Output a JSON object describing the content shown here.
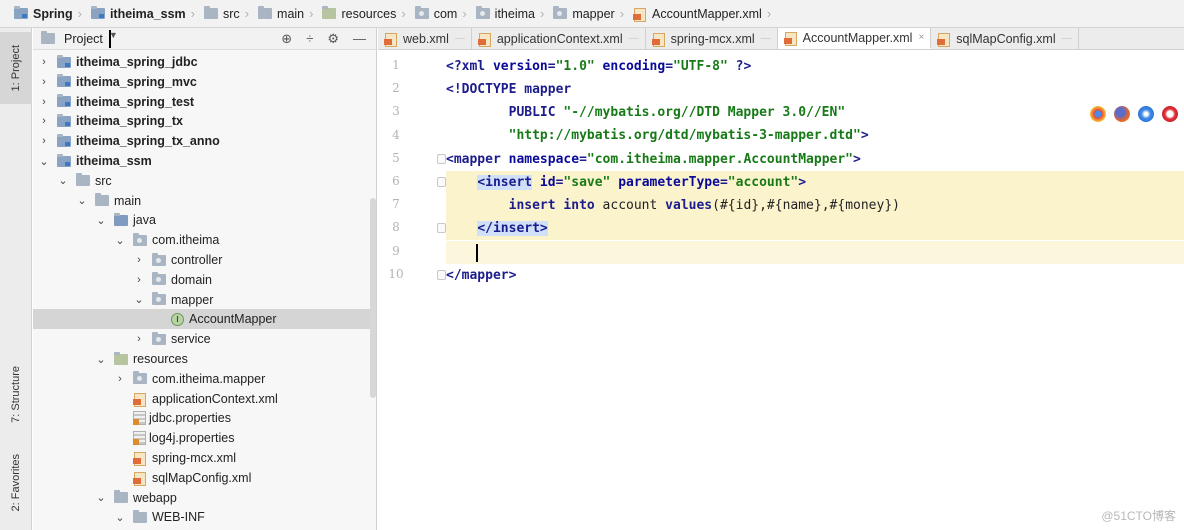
{
  "breadcrumb": [
    "Spring",
    "itheima_ssm",
    "src",
    "main",
    "resources",
    "com",
    "itheima",
    "mapper",
    "AccountMapper.xml"
  ],
  "toolstrip": {
    "project_tab": "1: Project",
    "structure_tab": "7: Structure",
    "favorites_tab": "2: Favorites"
  },
  "project_panel": {
    "title": "Project",
    "tree": [
      {
        "label": "itheima_spring_jdbc",
        "depth": 1,
        "chev": "›",
        "icon": "module",
        "bold": true
      },
      {
        "label": "itheima_spring_mvc",
        "depth": 1,
        "chev": "›",
        "icon": "module",
        "bold": true
      },
      {
        "label": "itheima_spring_test",
        "depth": 1,
        "chev": "›",
        "icon": "module",
        "bold": true
      },
      {
        "label": "itheima_spring_tx",
        "depth": 1,
        "chev": "›",
        "icon": "module",
        "bold": true
      },
      {
        "label": "itheima_spring_tx_anno",
        "depth": 1,
        "chev": "›",
        "icon": "module",
        "bold": true
      },
      {
        "label": "itheima_ssm",
        "depth": 1,
        "chev": "⌄",
        "icon": "module",
        "bold": true
      },
      {
        "label": "src",
        "depth": 2,
        "chev": "⌄",
        "icon": "folder"
      },
      {
        "label": "main",
        "depth": 3,
        "chev": "⌄",
        "icon": "folder"
      },
      {
        "label": "java",
        "depth": 4,
        "chev": "⌄",
        "icon": "source"
      },
      {
        "label": "com.itheima",
        "depth": 5,
        "chev": "⌄",
        "icon": "package"
      },
      {
        "label": "controller",
        "depth": 6,
        "chev": "›",
        "icon": "package"
      },
      {
        "label": "domain",
        "depth": 6,
        "chev": "›",
        "icon": "package"
      },
      {
        "label": "mapper",
        "depth": 6,
        "chev": "⌄",
        "icon": "package"
      },
      {
        "label": "AccountMapper",
        "depth": 7,
        "chev": "",
        "icon": "interface",
        "selected": true
      },
      {
        "label": "service",
        "depth": 6,
        "chev": "›",
        "icon": "package"
      },
      {
        "label": "resources",
        "depth": 4,
        "chev": "⌄",
        "icon": "resources"
      },
      {
        "label": "com.itheima.mapper",
        "depth": 5,
        "chev": "›",
        "icon": "package"
      },
      {
        "label": "applicationContext.xml",
        "depth": 5,
        "chev": "",
        "icon": "xml"
      },
      {
        "label": "jdbc.properties",
        "depth": 5,
        "chev": "",
        "icon": "properties"
      },
      {
        "label": "log4j.properties",
        "depth": 5,
        "chev": "",
        "icon": "properties"
      },
      {
        "label": "spring-mcx.xml",
        "depth": 5,
        "chev": "",
        "icon": "xml"
      },
      {
        "label": "sqlMapConfig.xml",
        "depth": 5,
        "chev": "",
        "icon": "xml"
      },
      {
        "label": "webapp",
        "depth": 4,
        "chev": "⌄",
        "icon": "folder"
      },
      {
        "label": "WEB-INF",
        "depth": 5,
        "chev": "⌄",
        "icon": "folder"
      }
    ]
  },
  "editor": {
    "tabs": [
      {
        "label": "web.xml",
        "active": false
      },
      {
        "label": "applicationContext.xml",
        "active": false
      },
      {
        "label": "spring-mcx.xml",
        "active": false
      },
      {
        "label": "AccountMapper.xml",
        "active": true
      },
      {
        "label": "sqlMapConfig.xml",
        "active": false
      }
    ],
    "line_numbers": [
      "1",
      "2",
      "3",
      "4",
      "5",
      "6",
      "7",
      "8",
      "9",
      "10"
    ],
    "lines": {
      "l1a": "<?",
      "l1b": "xml ",
      "l1c": "version",
      "l1d": "=",
      "l1e": "\"1.0\"",
      "l1f": " encoding",
      "l1g": "=",
      "l1h": "\"UTF-8\"",
      "l1i": " ?>",
      "l2": "<!DOCTYPE mapper",
      "l3a": "        PUBLIC ",
      "l3b": "\"-//mybatis.org//DTD Mapper 3.0//EN\"",
      "l4a": "        ",
      "l4b": "\"http://mybatis.org/dtd/mybatis-3-mapper.dtd\"",
      "l4c": ">",
      "l5a": "<",
      "l5b": "mapper ",
      "l5c": "namespace",
      "l5d": "=",
      "l5e": "\"com.itheima.mapper.AccountMapper\"",
      "l5f": ">",
      "l6a": "    ",
      "l6b": "<insert",
      "l6c": " id",
      "l6d": "=",
      "l6e": "\"save\"",
      "l6f": " parameterType",
      "l6g": "=",
      "l6h": "\"account\"",
      "l6i": ">",
      "l7a": "        ",
      "l7b": "insert into ",
      "l7c": "account ",
      "l7d": "values",
      "l7e": "(#{id},#{name},#{money})",
      "l8a": "    ",
      "l8b": "</insert>",
      "l10": "</mapper>"
    }
  },
  "browser_icons": [
    "chrome-icon",
    "firefox-icon",
    "safari-icon",
    "opera-icon"
  ],
  "watermark": "@51CTO博客"
}
